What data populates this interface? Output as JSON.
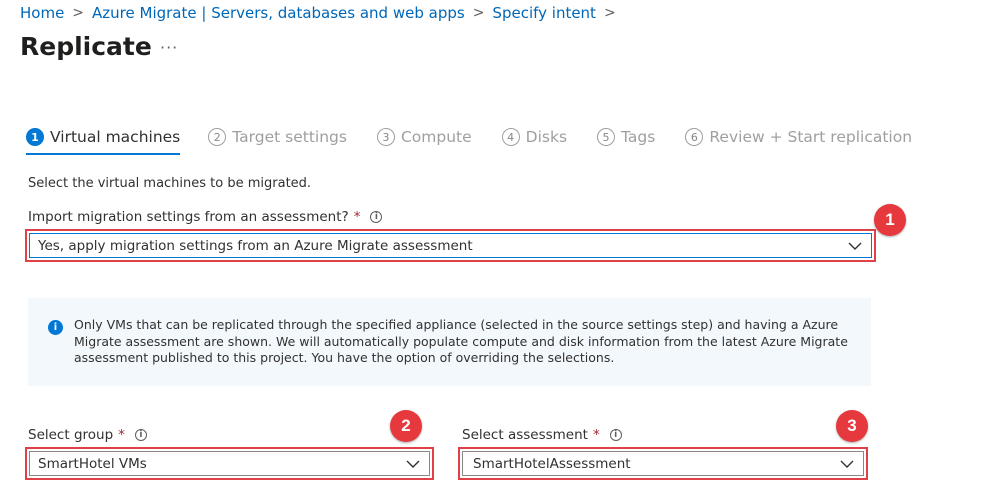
{
  "breadcrumb": {
    "items": [
      "Home",
      "Azure Migrate | Servers, databases and web apps",
      "Specify intent"
    ],
    "separator": ">"
  },
  "page": {
    "title": "Replicate",
    "more": "···"
  },
  "tabs": [
    {
      "num": "1",
      "label": "Virtual machines",
      "active": true
    },
    {
      "num": "2",
      "label": "Target settings"
    },
    {
      "num": "3",
      "label": "Compute"
    },
    {
      "num": "4",
      "label": "Disks"
    },
    {
      "num": "5",
      "label": "Tags"
    },
    {
      "num": "6",
      "label": "Review + Start replication"
    }
  ],
  "intro": "Select the virtual machines to be migrated.",
  "import_settings": {
    "label": "Import migration settings from an assessment?",
    "required_mark": "*",
    "value": "Yes, apply migration settings from an Azure Migrate assessment"
  },
  "info_box": {
    "text": "Only VMs that can be replicated through the specified appliance (selected  in the source settings step) and having a Azure Migrate assessment are shown. We will automatically populate compute and disk information from the latest Azure Migrate assessment published to this project. You have the option of overriding the selections."
  },
  "select_group": {
    "label": "Select group",
    "required_mark": "*",
    "value": "SmartHotel VMs"
  },
  "select_assessment": {
    "label": "Select assessment",
    "required_mark": "*",
    "value": "SmartHotelAssessment"
  },
  "callouts": [
    "1",
    "2",
    "3"
  ],
  "icons": {
    "info": "i",
    "chevron": "chevron-down-icon"
  },
  "colors": {
    "accent": "#0078d4",
    "link": "#0067b8",
    "highlight": "#e04148",
    "badge": "#e5393d",
    "required": "#a4262c"
  }
}
